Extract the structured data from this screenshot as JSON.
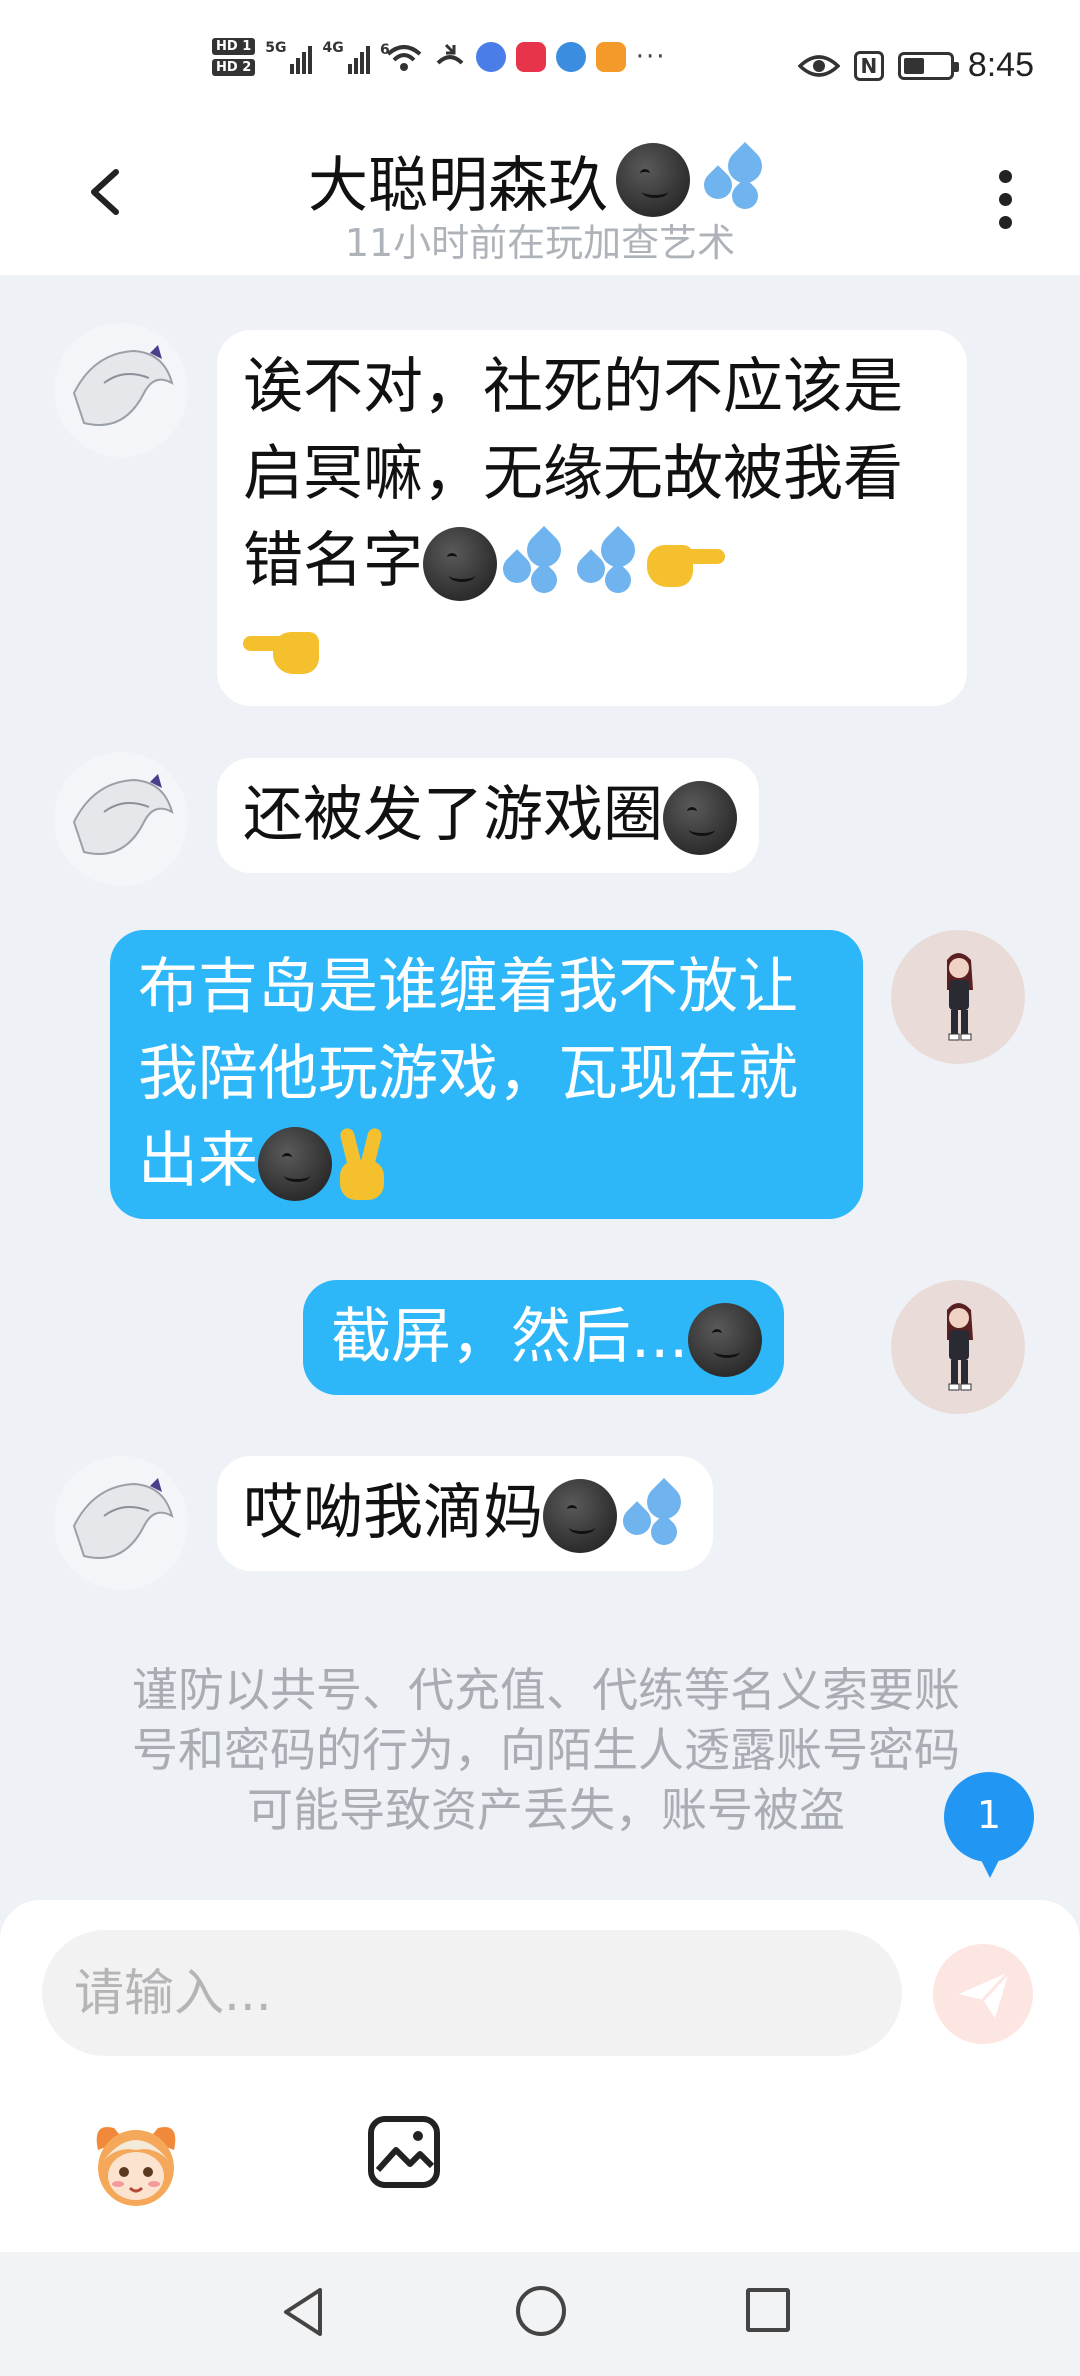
{
  "status_bar": {
    "time": "8:45",
    "hd1": "HD 1",
    "hd2": "HD 2",
    "net1": "5G",
    "net2": "4G",
    "wifi_tag": "6",
    "more": "···",
    "nfc": "N",
    "battery_level": 0.45
  },
  "header": {
    "title": "大聪明森玖",
    "subtitle": "11小时前在玩加查艺术"
  },
  "messages": [
    {
      "side": "in",
      "text": "诶不对，社死的不应该是启冥嘛，无缘无故被我看错名字",
      "emojis": [
        "smirk-moon",
        "sweat-drops",
        "sweat-drops",
        "point-right",
        "point-left"
      ]
    },
    {
      "side": "in",
      "text": "还被发了游戏圈",
      "emojis": [
        "smirk-moon"
      ]
    },
    {
      "side": "out",
      "text": "布吉岛是谁缠着我不放让我陪他玩游戏，瓦现在就出来",
      "emojis": [
        "smirk-moon",
        "victory-hand"
      ]
    },
    {
      "side": "out",
      "text": "截屏，然后...",
      "emojis": [
        "smirk-moon"
      ]
    },
    {
      "side": "in",
      "text": "哎呦我滴妈",
      "emojis": [
        "smirk-moon",
        "sweat-drops"
      ]
    }
  ],
  "notice": "谨防以共号、代充值、代练等名义索要账号和密码的行为，向陌生人透露账号密码可能导致资产丢失，账号被盗",
  "unread_badge": "1",
  "input": {
    "placeholder": "请输入..."
  },
  "icons": {
    "back": "chevron-left-icon",
    "more": "more-vertical-icon",
    "send": "send-icon",
    "emoji": "mascot-sticker-icon",
    "image": "image-icon"
  },
  "colors": {
    "outgoing_bubble": "#2db7f8",
    "incoming_bubble": "#ffffff",
    "background": "#eef1f6",
    "badge": "#2196f3",
    "send_button": "#fde5e2"
  }
}
